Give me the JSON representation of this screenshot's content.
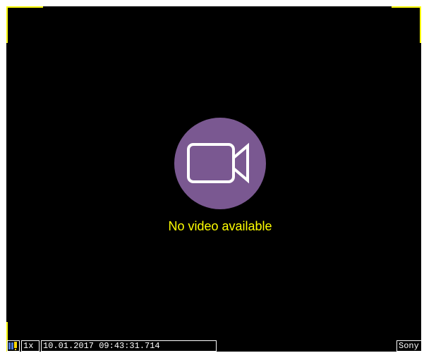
{
  "viewer": {
    "message": "No video available",
    "message_color": "#ffff00",
    "icon": "video-camera-icon",
    "icon_background": "#7a5891",
    "frame_marker_color": "#ffff00"
  },
  "status_bar": {
    "stream_icon": "stream-status-icon",
    "speed": "1x",
    "timestamp": "10.01.2017 09:43:31.714",
    "camera_name": "Sony"
  }
}
